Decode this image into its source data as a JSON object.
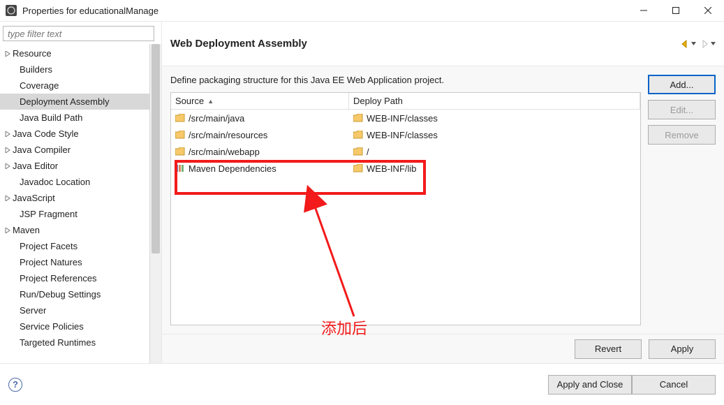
{
  "window": {
    "title": "Properties for educationalManage"
  },
  "sidebar": {
    "filter_placeholder": "type filter text",
    "items": [
      {
        "label": "Resource",
        "expandable": true,
        "depth": 0
      },
      {
        "label": "Builders",
        "expandable": false,
        "depth": 1
      },
      {
        "label": "Coverage",
        "expandable": false,
        "depth": 1
      },
      {
        "label": "Deployment Assembly",
        "expandable": false,
        "depth": 1,
        "selected": true
      },
      {
        "label": "Java Build Path",
        "expandable": false,
        "depth": 1
      },
      {
        "label": "Java Code Style",
        "expandable": true,
        "depth": 0
      },
      {
        "label": "Java Compiler",
        "expandable": true,
        "depth": 0
      },
      {
        "label": "Java Editor",
        "expandable": true,
        "depth": 0
      },
      {
        "label": "Javadoc Location",
        "expandable": false,
        "depth": 1
      },
      {
        "label": "JavaScript",
        "expandable": true,
        "depth": 0
      },
      {
        "label": "JSP Fragment",
        "expandable": false,
        "depth": 1
      },
      {
        "label": "Maven",
        "expandable": true,
        "depth": 0
      },
      {
        "label": "Project Facets",
        "expandable": false,
        "depth": 1
      },
      {
        "label": "Project Natures",
        "expandable": false,
        "depth": 1
      },
      {
        "label": "Project References",
        "expandable": false,
        "depth": 1
      },
      {
        "label": "Run/Debug Settings",
        "expandable": false,
        "depth": 1
      },
      {
        "label": "Server",
        "expandable": false,
        "depth": 1
      },
      {
        "label": "Service Policies",
        "expandable": false,
        "depth": 1
      },
      {
        "label": "Targeted Runtimes",
        "expandable": false,
        "depth": 1
      }
    ]
  },
  "main": {
    "heading": "Web Deployment Assembly",
    "description": "Define packaging structure for this Java EE Web Application project.",
    "table": {
      "cols": {
        "source": "Source",
        "deploy": "Deploy Path"
      },
      "rows": [
        {
          "icon": "folder",
          "source": "/src/main/java",
          "deploy": "WEB-INF/classes"
        },
        {
          "icon": "folder",
          "source": "/src/main/resources",
          "deploy": "WEB-INF/classes"
        },
        {
          "icon": "folder",
          "source": "/src/main/webapp",
          "deploy": "/"
        },
        {
          "icon": "lib",
          "source": "Maven Dependencies",
          "deploy": "WEB-INF/lib"
        }
      ]
    },
    "buttons": {
      "add": "Add...",
      "edit": "Edit...",
      "remove": "Remove",
      "revert": "Revert",
      "apply": "Apply"
    },
    "annotation": "添加后"
  },
  "bottom": {
    "apply_close": "Apply and Close",
    "cancel": "Cancel"
  }
}
